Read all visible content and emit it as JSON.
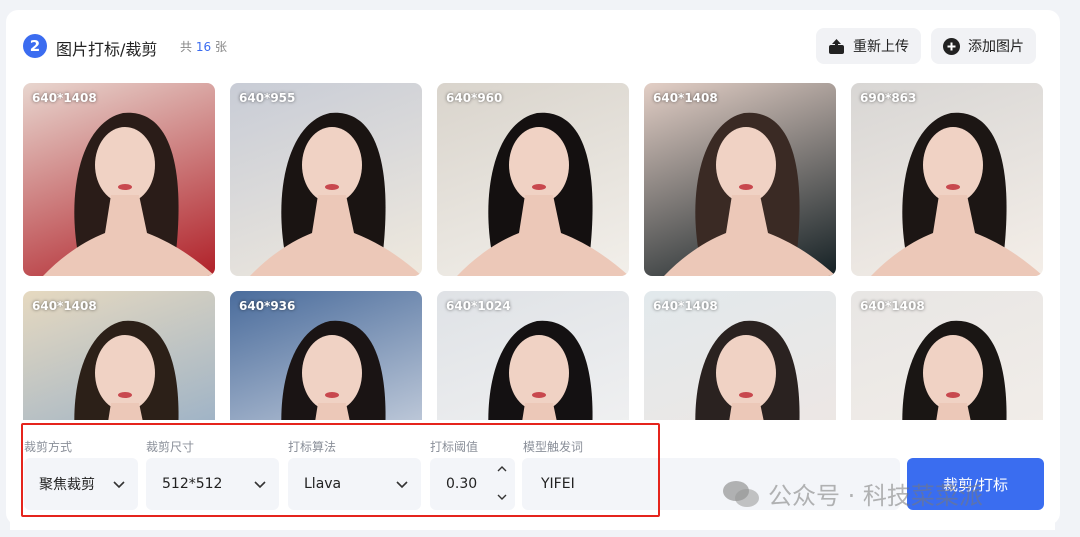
{
  "header": {
    "step_number": "2",
    "title": "图片打标/裁剪",
    "count_prefix": "共",
    "count_num": "16",
    "count_suffix": "张",
    "reupload_label": "重新上传",
    "add_image_label": "添加图片"
  },
  "images": [
    {
      "dims": "640*1408",
      "bg1": "#e8d6cf",
      "bg2": "#b02028",
      "hair": "#2a1c18"
    },
    {
      "dims": "640*955",
      "bg1": "#c8ccd6",
      "bg2": "#efe9de",
      "hair": "#1a1412"
    },
    {
      "dims": "640*960",
      "bg1": "#d9d4cc",
      "bg2": "#f2efea",
      "hair": "#141010"
    },
    {
      "dims": "640*1408",
      "bg1": "#e3cfc6",
      "bg2": "#142024",
      "hair": "#3a2a24"
    },
    {
      "dims": "690*863",
      "bg1": "#d8d6d4",
      "bg2": "#f4eee8",
      "hair": "#1c1614"
    },
    {
      "dims": "640*1408",
      "bg1": "#e6d9c0",
      "bg2": "#8aa8c8",
      "hair": "#2c2018"
    },
    {
      "dims": "640*936",
      "bg1": "#4a6c9c",
      "bg2": "#dfe3ea",
      "hair": "#1a1414"
    },
    {
      "dims": "640*1024",
      "bg1": "#dfe2e6",
      "bg2": "#f4f4f4",
      "hair": "#141112"
    },
    {
      "dims": "640*1408",
      "bg1": "#e2e9ec",
      "bg2": "#f0e6e2",
      "hair": "#2a2220"
    },
    {
      "dims": "640*1408",
      "bg1": "#e8e6e4",
      "bg2": "#f4efea",
      "hair": "#1a1614"
    }
  ],
  "controls": {
    "crop_mode_label": "裁剪方式",
    "crop_mode_value": "聚焦裁剪",
    "crop_size_label": "裁剪尺寸",
    "crop_size_value": "512*512",
    "tag_algo_label": "打标算法",
    "tag_algo_value": "Llava",
    "threshold_label": "打标阈值",
    "threshold_value": "0.30",
    "trigger_label": "模型触发词",
    "trigger_value": "YIFEI",
    "submit_label": "裁剪/打标"
  },
  "watermark": "公众号 · 科技菜菜派",
  "colors": {
    "accent": "#3b6cf0",
    "highlight": "#e5241c"
  }
}
